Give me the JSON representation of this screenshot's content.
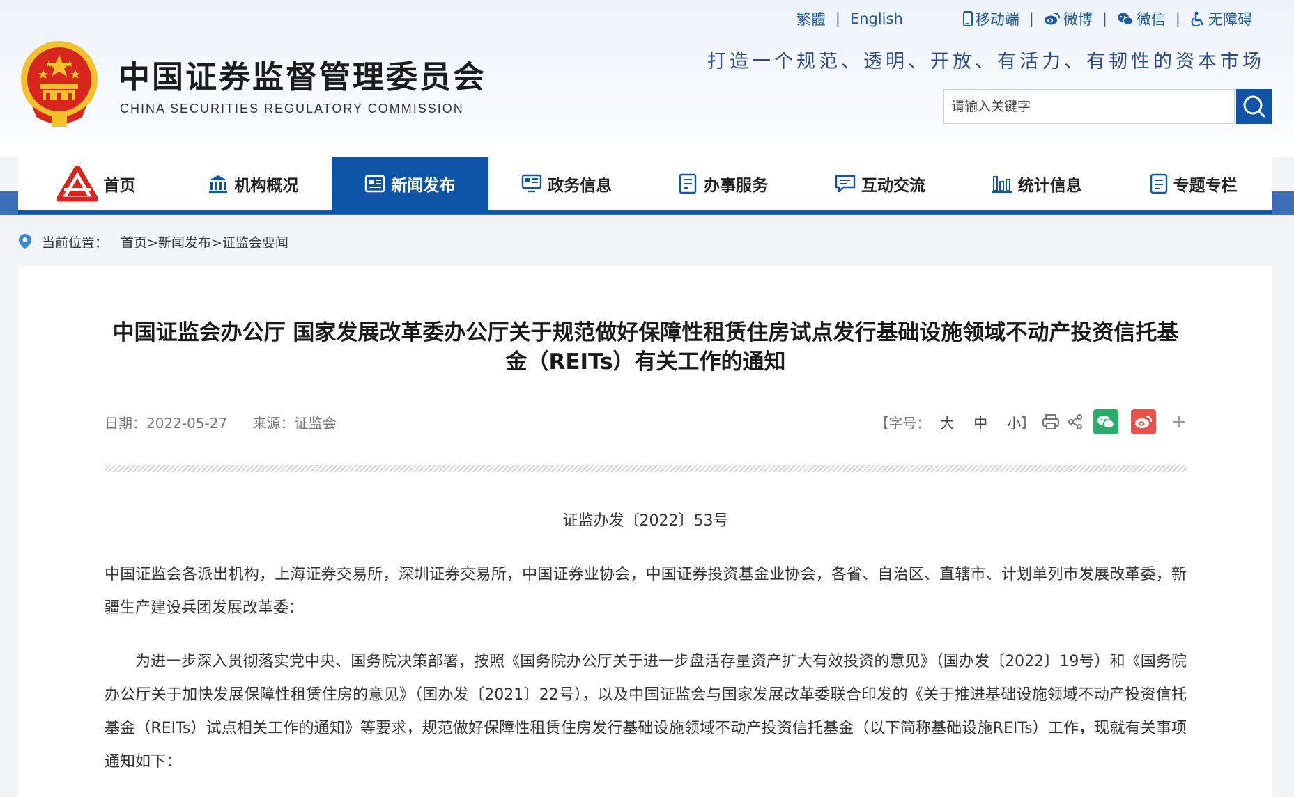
{
  "header": {
    "org_name_cn": "中国证券监督管理委员会",
    "org_name_en": "CHINA SECURITIES REGULATORY COMMISSION",
    "slogan": "打造一个规范、透明、开放、有活力、有韧性的资本市场",
    "top_links": {
      "traditional": "繁體",
      "english": "English",
      "mobile": "移动端",
      "weibo": "微博",
      "wechat": "微信",
      "accessibility": "无障碍"
    },
    "search": {
      "placeholder": "请输入关键字"
    }
  },
  "nav": {
    "items": [
      {
        "label": "首页"
      },
      {
        "label": "机构概况"
      },
      {
        "label": "新闻发布",
        "active": true
      },
      {
        "label": "政务信息"
      },
      {
        "label": "办事服务"
      },
      {
        "label": "互动交流"
      },
      {
        "label": "统计信息"
      },
      {
        "label": "专题专栏"
      }
    ]
  },
  "breadcrumb": {
    "label": "当前位置：",
    "path": "首页>新闻发布>证监会要闻"
  },
  "article": {
    "title": "中国证监会办公厅 国家发展改革委办公厅关于规范做好保障性租赁住房试点发行基础设施领域不动产投资信托基金（REITs）有关工作的通知",
    "date": "日期：2022-05-27",
    "source": "来源：证监会",
    "font_size": {
      "label_open": "【字号：",
      "large": "大",
      "medium": "中",
      "small": "小",
      "label_close": "】"
    },
    "more": "+",
    "doc_number": "证监办发〔2022〕53号",
    "paragraphs": [
      "中国证监会各派出机构，上海证券交易所，深圳证券交易所，中国证券业协会，中国证券投资基金业协会，各省、自治区、直辖市、计划单列市发展改革委，新疆生产建设兵团发展改革委：",
      "为进一步深入贯彻落实党中央、国务院决策部署，按照《国务院办公厅关于进一步盘活存量资产扩大有效投资的意见》（国办发〔2022〕19号）和《国务院办公厅关于加快发展保障性租赁住房的意见》（国办发〔2021〕22号），以及中国证监会与国家发展改革委联合印发的《关于推进基础设施领域不动产投资信托基金（REITs）试点相关工作的通知》等要求，规范做好保障性租赁住房发行基础设施领域不动产投资信托基金（以下简称基础设施REITs）工作，现就有关事项通知如下："
    ]
  },
  "colors": {
    "brand_blue": "#0e55a8",
    "link_blue": "#1a5aa6",
    "emblem_red": "#d7261e",
    "emblem_gold": "#f3c12c",
    "wechat_green": "#2aae67",
    "weibo_red": "#e5534b"
  },
  "icons": {
    "emblem": "national-emblem",
    "mobile": "mobile-phone-icon",
    "weibo": "weibo-icon",
    "wechat": "wechat-icon",
    "accessibility": "wheelchair-icon",
    "search": "magnifier-icon",
    "location": "location-pin-icon",
    "print": "printer-icon",
    "share": "share-icon"
  }
}
